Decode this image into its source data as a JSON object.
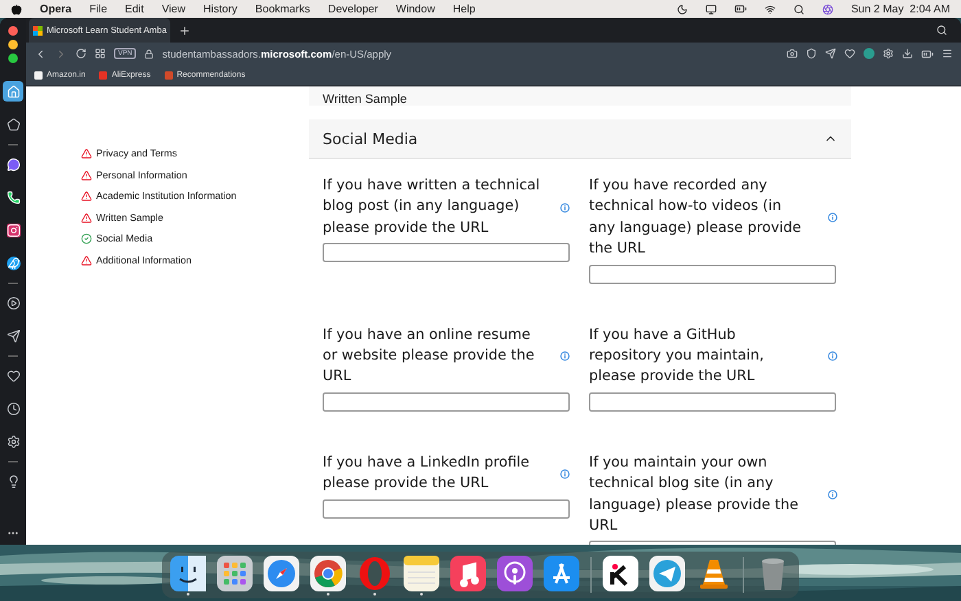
{
  "menu_bar": {
    "app": "Opera",
    "menus": [
      "File",
      "Edit",
      "View",
      "History",
      "Bookmarks",
      "Developer",
      "Window",
      "Help"
    ],
    "clock": "Sun 2 May  2:04 AM"
  },
  "browser": {
    "tab": {
      "title": "Microsoft Learn Student Amba",
      "selected": true
    },
    "vpn": "VPN",
    "url": "studentambassadors.**microsoft.com**/en-US/apply",
    "bookmarks": [
      {
        "kind": "amazon",
        "label": "Amazon.in"
      },
      {
        "kind": "aliexpress",
        "label": "AliExpress"
      },
      {
        "kind": "recommendations",
        "label": "Recommendations"
      }
    ],
    "sidebar": [
      {
        "kind": "home",
        "selected": true
      },
      {
        "kind": "speed-dial",
        "selected": false
      },
      {
        "kind": "messenger",
        "selected": false
      },
      {
        "kind": "whatsapp",
        "selected": false
      },
      {
        "kind": "instagram",
        "selected": false
      },
      {
        "kind": "twitter",
        "selected": false
      },
      {
        "kind": "player",
        "selected": false
      },
      {
        "kind": "send",
        "selected": false
      },
      {
        "kind": "heart",
        "selected": false
      },
      {
        "kind": "history",
        "selected": false
      },
      {
        "kind": "settings",
        "selected": false
      },
      {
        "kind": "tips",
        "selected": false
      }
    ]
  },
  "nav_items": [
    {
      "label": "Privacy and Terms",
      "complete": false
    },
    {
      "label": "Personal Information",
      "complete": false
    },
    {
      "label": "Academic Institution Information",
      "complete": false
    },
    {
      "label": "Written Sample",
      "complete": false
    },
    {
      "label": "Social Media",
      "complete": true
    },
    {
      "label": "Additional Information",
      "complete": false
    }
  ],
  "previous_section": {
    "title": "Written Sample"
  },
  "section": {
    "title": "Social Media",
    "expanded": true,
    "fields": [
      {
        "label": "If you have written a technical blog post (in any language) please provide the URL"
      },
      {
        "label": "If you have recorded any technical how-to videos (in any language) please provide the URL"
      },
      {
        "label": "If you have an online resume or website please provide the URL"
      },
      {
        "label": "If you have a GitHub repository you maintain, please provide the URL"
      },
      {
        "label": "If you have a LinkedIn profile please provide the URL"
      },
      {
        "label": "If you maintain your own technical blog site (in any language) please provide the URL"
      }
    ]
  },
  "dock": [
    {
      "kind": "finder",
      "running": true
    },
    {
      "kind": "launchpad",
      "running": false
    },
    {
      "kind": "safari",
      "running": false
    },
    {
      "kind": "chrome",
      "running": true
    },
    {
      "kind": "opera",
      "running": true
    },
    {
      "kind": "notes",
      "running": true
    },
    {
      "kind": "music",
      "running": false
    },
    {
      "kind": "podcasts",
      "running": false
    },
    {
      "kind": "appstore",
      "running": false
    },
    {
      "kind": "divider"
    },
    {
      "kind": "kite",
      "running": false
    },
    {
      "kind": "telegram",
      "running": false
    },
    {
      "kind": "vlc",
      "running": false
    },
    {
      "kind": "divider"
    },
    {
      "kind": "trash",
      "running": false
    }
  ]
}
